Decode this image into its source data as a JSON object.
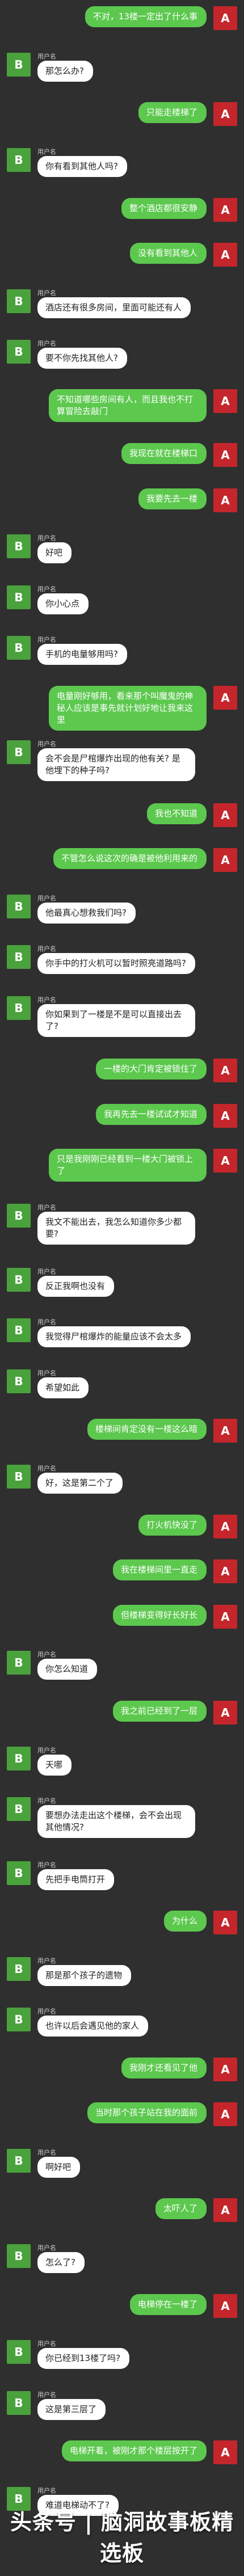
{
  "colors": {
    "background": "#2f2f2f",
    "a_avatar": "#c4262b",
    "b_avatar": "#4aa23c",
    "green_bubble": "#5cc84e",
    "white_bubble": "#ffffff"
  },
  "avatar_labels": {
    "a": "A",
    "b": "B"
  },
  "sender_name": "用户名",
  "messages": [
    {
      "from": "A",
      "text": "不对，13楼一定出了什么事"
    },
    {
      "from": "B",
      "text": "那怎么办?"
    },
    {
      "from": "A",
      "text": "只能走楼梯了"
    },
    {
      "from": "B",
      "text": "你有看到其他人吗?"
    },
    {
      "from": "A",
      "text": "整个酒店都很安静"
    },
    {
      "from": "A",
      "text": "没有看到其他人"
    },
    {
      "from": "B",
      "text": "酒店还有很多房间，里面可能还有人"
    },
    {
      "from": "B",
      "text": "要不你先找其他人?"
    },
    {
      "from": "A",
      "text": "不知道哪些房间有人，而且我也不打算冒险去敲门"
    },
    {
      "from": "A",
      "text": "我现在就在楼梯口"
    },
    {
      "from": "A",
      "text": "我要先去一楼"
    },
    {
      "from": "B",
      "text": "好吧"
    },
    {
      "from": "B",
      "text": "你小心点"
    },
    {
      "from": "B",
      "text": "手机的电量够用吗?"
    },
    {
      "from": "A",
      "text": "电量刚好够用，看来那个叫魔鬼的神秘人应该是事先就计划好地让我来这里"
    },
    {
      "from": "B",
      "text": "会不会是尸棺爆炸出现的他有关? 是他埋下的种子吗?"
    },
    {
      "from": "A",
      "text": "我也不知道"
    },
    {
      "from": "A",
      "text": "不管怎么说这次的确是被他利用来的"
    },
    {
      "from": "B",
      "text": "他最真心想救我们吗?"
    },
    {
      "from": "B",
      "text": "你手中的打火机可以暂时照亮道路吗?"
    },
    {
      "from": "B",
      "text": "你如果到了一楼是不是可以直接出去了?"
    },
    {
      "from": "A",
      "text": "一楼的大门肯定被锁住了"
    },
    {
      "from": "A",
      "text": "我再先去一楼试试才知道"
    },
    {
      "from": "A",
      "text": "只是我刚刚已经看到一楼大门被锁上了"
    },
    {
      "from": "B",
      "text": "我文不能出去，我怎么知道你多少都要?"
    },
    {
      "from": "B",
      "text": "反正我啊也没有"
    },
    {
      "from": "B",
      "text": "我觉得尸棺爆炸的能量应该不会太多"
    },
    {
      "from": "B",
      "text": "希望如此"
    },
    {
      "from": "A",
      "text": "楼梯间肯定没有一楼这么暗"
    },
    {
      "from": "B",
      "text": "好，这是第二个了"
    },
    {
      "from": "A",
      "text": "打火机快没了"
    },
    {
      "from": "A",
      "text": "我在楼梯间里一直走"
    },
    {
      "from": "A",
      "text": "但楼梯变得好长好长"
    },
    {
      "from": "B",
      "text": "你怎么知道"
    },
    {
      "from": "A",
      "text": "我之前已经到了一层"
    },
    {
      "from": "B",
      "text": "天哪"
    },
    {
      "from": "B",
      "text": "要想办法走出这个楼梯，会不会出现其他情况?"
    },
    {
      "from": "B",
      "text": "先把手电筒打开"
    },
    {
      "from": "A",
      "text": "为什么"
    },
    {
      "from": "B",
      "text": "那是那个孩子的遗物"
    },
    {
      "from": "B",
      "text": "也许以后会遇见他的家人"
    },
    {
      "from": "A",
      "text": "我刚才还看见了他"
    },
    {
      "from": "A",
      "text": "当时那个孩子站在我的面前"
    },
    {
      "from": "B",
      "text": "啊好吧"
    },
    {
      "from": "A",
      "text": "太吓人了"
    },
    {
      "from": "B",
      "text": "怎么了?"
    },
    {
      "from": "A",
      "text": "电梯停在一楼了"
    },
    {
      "from": "B",
      "text": "你已经到13楼了吗?"
    },
    {
      "from": "B",
      "text": "这是第三层了"
    },
    {
      "from": "A",
      "text": "电梯开着，被刚才那个楼层按开了"
    },
    {
      "from": "B",
      "text": "难道电梯动不了?"
    }
  ],
  "watermark": "头条号 | 脑洞故事板精选板"
}
